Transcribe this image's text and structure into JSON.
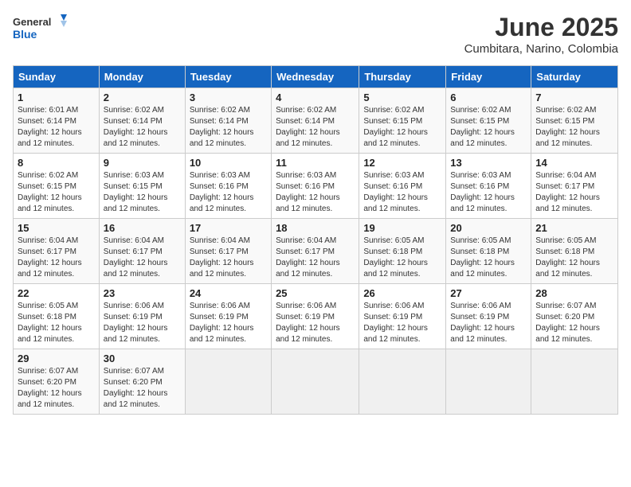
{
  "header": {
    "logo_general": "General",
    "logo_blue": "Blue",
    "month_year": "June 2025",
    "location": "Cumbitara, Narino, Colombia"
  },
  "days_of_week": [
    "Sunday",
    "Monday",
    "Tuesday",
    "Wednesday",
    "Thursday",
    "Friday",
    "Saturday"
  ],
  "weeks": [
    [
      {
        "day": "1",
        "sunrise": "Sunrise: 6:01 AM",
        "sunset": "Sunset: 6:14 PM",
        "daylight": "Daylight: 12 hours and 12 minutes."
      },
      {
        "day": "2",
        "sunrise": "Sunrise: 6:02 AM",
        "sunset": "Sunset: 6:14 PM",
        "daylight": "Daylight: 12 hours and 12 minutes."
      },
      {
        "day": "3",
        "sunrise": "Sunrise: 6:02 AM",
        "sunset": "Sunset: 6:14 PM",
        "daylight": "Daylight: 12 hours and 12 minutes."
      },
      {
        "day": "4",
        "sunrise": "Sunrise: 6:02 AM",
        "sunset": "Sunset: 6:14 PM",
        "daylight": "Daylight: 12 hours and 12 minutes."
      },
      {
        "day": "5",
        "sunrise": "Sunrise: 6:02 AM",
        "sunset": "Sunset: 6:15 PM",
        "daylight": "Daylight: 12 hours and 12 minutes."
      },
      {
        "day": "6",
        "sunrise": "Sunrise: 6:02 AM",
        "sunset": "Sunset: 6:15 PM",
        "daylight": "Daylight: 12 hours and 12 minutes."
      },
      {
        "day": "7",
        "sunrise": "Sunrise: 6:02 AM",
        "sunset": "Sunset: 6:15 PM",
        "daylight": "Daylight: 12 hours and 12 minutes."
      }
    ],
    [
      {
        "day": "8",
        "sunrise": "Sunrise: 6:02 AM",
        "sunset": "Sunset: 6:15 PM",
        "daylight": "Daylight: 12 hours and 12 minutes."
      },
      {
        "day": "9",
        "sunrise": "Sunrise: 6:03 AM",
        "sunset": "Sunset: 6:15 PM",
        "daylight": "Daylight: 12 hours and 12 minutes."
      },
      {
        "day": "10",
        "sunrise": "Sunrise: 6:03 AM",
        "sunset": "Sunset: 6:16 PM",
        "daylight": "Daylight: 12 hours and 12 minutes."
      },
      {
        "day": "11",
        "sunrise": "Sunrise: 6:03 AM",
        "sunset": "Sunset: 6:16 PM",
        "daylight": "Daylight: 12 hours and 12 minutes."
      },
      {
        "day": "12",
        "sunrise": "Sunrise: 6:03 AM",
        "sunset": "Sunset: 6:16 PM",
        "daylight": "Daylight: 12 hours and 12 minutes."
      },
      {
        "day": "13",
        "sunrise": "Sunrise: 6:03 AM",
        "sunset": "Sunset: 6:16 PM",
        "daylight": "Daylight: 12 hours and 12 minutes."
      },
      {
        "day": "14",
        "sunrise": "Sunrise: 6:04 AM",
        "sunset": "Sunset: 6:17 PM",
        "daylight": "Daylight: 12 hours and 12 minutes."
      }
    ],
    [
      {
        "day": "15",
        "sunrise": "Sunrise: 6:04 AM",
        "sunset": "Sunset: 6:17 PM",
        "daylight": "Daylight: 12 hours and 12 minutes."
      },
      {
        "day": "16",
        "sunrise": "Sunrise: 6:04 AM",
        "sunset": "Sunset: 6:17 PM",
        "daylight": "Daylight: 12 hours and 12 minutes."
      },
      {
        "day": "17",
        "sunrise": "Sunrise: 6:04 AM",
        "sunset": "Sunset: 6:17 PM",
        "daylight": "Daylight: 12 hours and 12 minutes."
      },
      {
        "day": "18",
        "sunrise": "Sunrise: 6:04 AM",
        "sunset": "Sunset: 6:17 PM",
        "daylight": "Daylight: 12 hours and 12 minutes."
      },
      {
        "day": "19",
        "sunrise": "Sunrise: 6:05 AM",
        "sunset": "Sunset: 6:18 PM",
        "daylight": "Daylight: 12 hours and 12 minutes."
      },
      {
        "day": "20",
        "sunrise": "Sunrise: 6:05 AM",
        "sunset": "Sunset: 6:18 PM",
        "daylight": "Daylight: 12 hours and 12 minutes."
      },
      {
        "day": "21",
        "sunrise": "Sunrise: 6:05 AM",
        "sunset": "Sunset: 6:18 PM",
        "daylight": "Daylight: 12 hours and 12 minutes."
      }
    ],
    [
      {
        "day": "22",
        "sunrise": "Sunrise: 6:05 AM",
        "sunset": "Sunset: 6:18 PM",
        "daylight": "Daylight: 12 hours and 12 minutes."
      },
      {
        "day": "23",
        "sunrise": "Sunrise: 6:06 AM",
        "sunset": "Sunset: 6:19 PM",
        "daylight": "Daylight: 12 hours and 12 minutes."
      },
      {
        "day": "24",
        "sunrise": "Sunrise: 6:06 AM",
        "sunset": "Sunset: 6:19 PM",
        "daylight": "Daylight: 12 hours and 12 minutes."
      },
      {
        "day": "25",
        "sunrise": "Sunrise: 6:06 AM",
        "sunset": "Sunset: 6:19 PM",
        "daylight": "Daylight: 12 hours and 12 minutes."
      },
      {
        "day": "26",
        "sunrise": "Sunrise: 6:06 AM",
        "sunset": "Sunset: 6:19 PM",
        "daylight": "Daylight: 12 hours and 12 minutes."
      },
      {
        "day": "27",
        "sunrise": "Sunrise: 6:06 AM",
        "sunset": "Sunset: 6:19 PM",
        "daylight": "Daylight: 12 hours and 12 minutes."
      },
      {
        "day": "28",
        "sunrise": "Sunrise: 6:07 AM",
        "sunset": "Sunset: 6:20 PM",
        "daylight": "Daylight: 12 hours and 12 minutes."
      }
    ],
    [
      {
        "day": "29",
        "sunrise": "Sunrise: 6:07 AM",
        "sunset": "Sunset: 6:20 PM",
        "daylight": "Daylight: 12 hours and 12 minutes."
      },
      {
        "day": "30",
        "sunrise": "Sunrise: 6:07 AM",
        "sunset": "Sunset: 6:20 PM",
        "daylight": "Daylight: 12 hours and 12 minutes."
      },
      {
        "day": "",
        "sunrise": "",
        "sunset": "",
        "daylight": ""
      },
      {
        "day": "",
        "sunrise": "",
        "sunset": "",
        "daylight": ""
      },
      {
        "day": "",
        "sunrise": "",
        "sunset": "",
        "daylight": ""
      },
      {
        "day": "",
        "sunrise": "",
        "sunset": "",
        "daylight": ""
      },
      {
        "day": "",
        "sunrise": "",
        "sunset": "",
        "daylight": ""
      }
    ]
  ]
}
